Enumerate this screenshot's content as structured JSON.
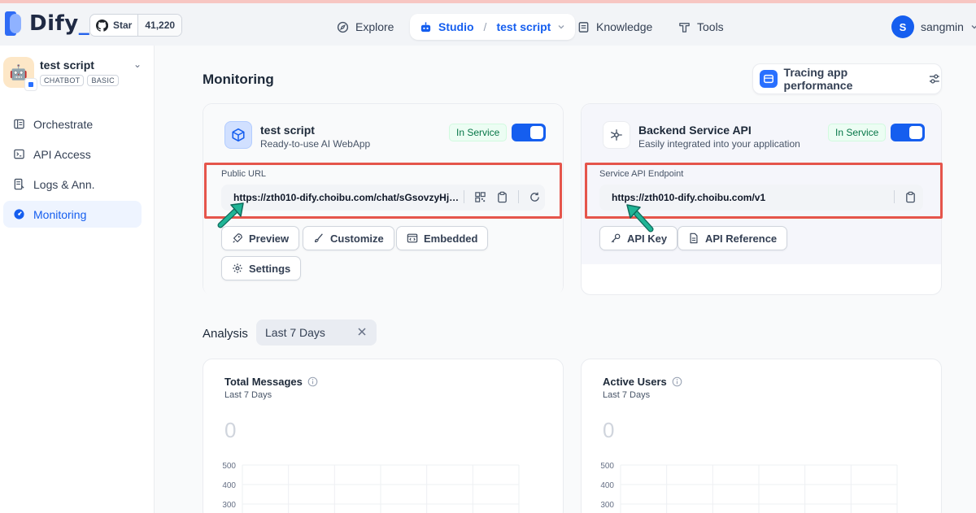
{
  "brand": {
    "logo_text": "Dify",
    "logo_underscore": "_"
  },
  "github": {
    "star_label": "Star",
    "star_count": "41,220"
  },
  "nav": {
    "explore": "Explore",
    "studio": "Studio",
    "studio_app": "test script",
    "knowledge": "Knowledge",
    "tools": "Tools"
  },
  "user": {
    "initial": "S",
    "name": "sangmin"
  },
  "app": {
    "name": "test script",
    "tags": [
      "CHATBOT",
      "BASIC"
    ]
  },
  "sidebar": {
    "items": [
      {
        "label": "Orchestrate",
        "icon": "orchestrate-icon"
      },
      {
        "label": "API Access",
        "icon": "terminal-icon"
      },
      {
        "label": "Logs & Ann.",
        "icon": "logs-icon"
      },
      {
        "label": "Monitoring",
        "icon": "monitoring-icon",
        "active": true
      }
    ]
  },
  "page": {
    "title": "Monitoring"
  },
  "tracing": {
    "label": "Tracing app performance"
  },
  "webapp_card": {
    "title": "test script",
    "subtitle": "Ready-to-use AI WebApp",
    "status": "In Service",
    "field_label": "Public URL",
    "url": "https://zth010-dify.choibu.com/chat/sGsovzyHjOz...",
    "buttons": {
      "preview": "Preview",
      "customize": "Customize",
      "embedded": "Embedded",
      "settings": "Settings"
    }
  },
  "api_card": {
    "title": "Backend Service API",
    "subtitle": "Easily integrated into your application",
    "status": "In Service",
    "field_label": "Service API Endpoint",
    "url": "https://zth010-dify.choibu.com/v1",
    "buttons": {
      "api_key": "API Key",
      "api_reference": "API Reference"
    }
  },
  "analysis": {
    "label": "Analysis",
    "period": "Last 7 Days"
  },
  "charts": {
    "messages": {
      "title": "Total Messages",
      "subtitle": "Last 7 Days",
      "total": "0"
    },
    "users": {
      "title": "Active Users",
      "subtitle": "Last 7 Days",
      "total": "0"
    }
  },
  "chart_data": [
    {
      "type": "line",
      "title": "Total Messages",
      "subtitle": "Last 7 Days",
      "yticks": [
        500,
        400,
        300
      ],
      "ylim": [
        0,
        500
      ],
      "grid": true
    },
    {
      "type": "line",
      "title": "Active Users",
      "subtitle": "Last 7 Days",
      "yticks": [
        500,
        400,
        300
      ],
      "ylim": [
        0,
        500
      ],
      "grid": true
    }
  ],
  "colors": {
    "primary": "#155eef",
    "highlight": "#e5554b",
    "arrow": "#17a589",
    "status_green": "#067647"
  }
}
